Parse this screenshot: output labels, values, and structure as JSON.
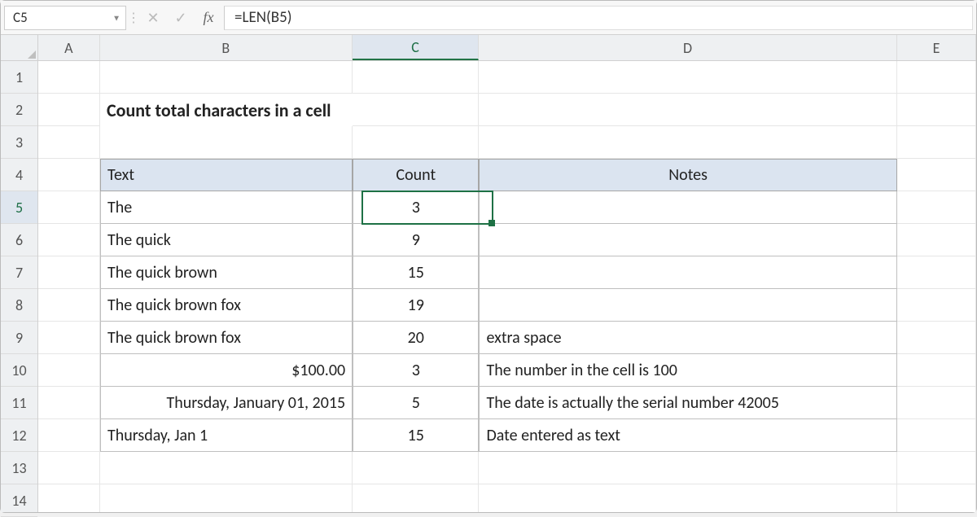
{
  "formula_bar": {
    "cell_ref": "C5",
    "formula": "=LEN(B5)",
    "cancel_icon": "✕",
    "enter_icon": "✓",
    "fx_label": "fx"
  },
  "columns": [
    "A",
    "B",
    "C",
    "D",
    "E"
  ],
  "row_numbers": [
    "1",
    "2",
    "3",
    "4",
    "5",
    "6",
    "7",
    "8",
    "9",
    "10",
    "11",
    "12",
    "13",
    "14"
  ],
  "title": "Count total characters in a cell",
  "table": {
    "headers": {
      "text": "Text",
      "count": "Count",
      "notes": "Notes"
    },
    "rows": [
      {
        "text": "The",
        "count": "3",
        "notes": ""
      },
      {
        "text": "The quick",
        "count": "9",
        "notes": ""
      },
      {
        "text": "The quick brown",
        "count": "15",
        "notes": ""
      },
      {
        "text": "The quick brown fox",
        "count": "19",
        "notes": ""
      },
      {
        "text": "The quick brown  fox",
        "count": "20",
        "notes": "extra space"
      },
      {
        "text": "$100.00",
        "count": "3",
        "notes": "The number in the cell is 100",
        "right": true
      },
      {
        "text": "Thursday, January 01, 2015",
        "count": "5",
        "notes": "The date is actually the serial number 42005",
        "right": true
      },
      {
        "text": "Thursday, Jan 1",
        "count": "15",
        "notes": "Date entered as text"
      }
    ]
  },
  "active": {
    "row_index": 4,
    "col_index": 2
  }
}
